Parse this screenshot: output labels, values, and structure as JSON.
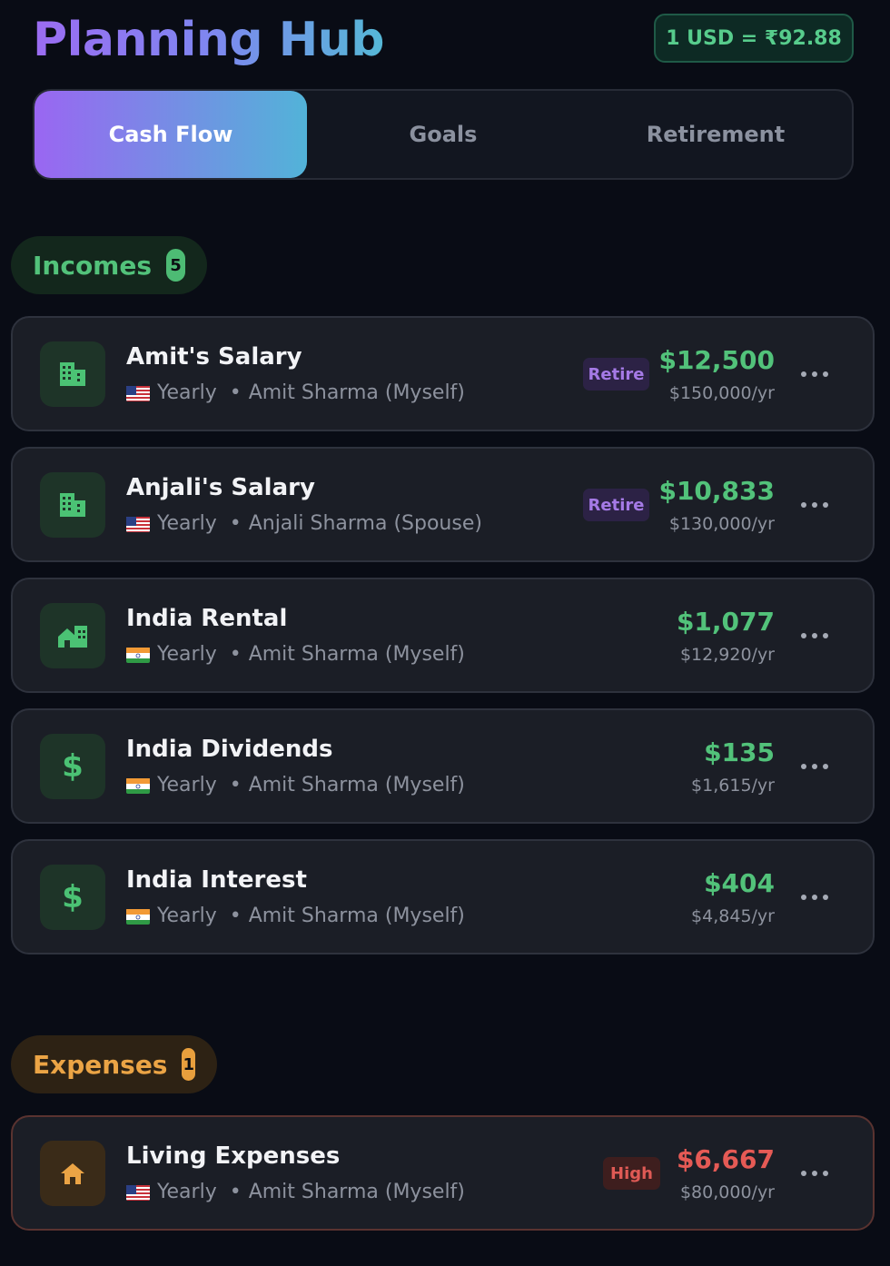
{
  "header": {
    "title": "Planning Hub",
    "exchange_rate": "1 USD = ₹92.88"
  },
  "tabs": [
    {
      "label": "Cash Flow",
      "active": true
    },
    {
      "label": "Goals",
      "active": false
    },
    {
      "label": "Retirement",
      "active": false
    }
  ],
  "incomes": {
    "label": "Incomes",
    "count": "5",
    "items": [
      {
        "name": "Amit's Salary",
        "flag": "us-flag-icon",
        "frequency": "Yearly",
        "owner": "Amit Sharma (Myself)",
        "badge": "Retire",
        "amount": "$12,500",
        "annual": "$150,000/yr",
        "icon": "building-icon"
      },
      {
        "name": "Anjali's Salary",
        "flag": "us-flag-icon",
        "frequency": "Yearly",
        "owner": "Anjali Sharma (Spouse)",
        "badge": "Retire",
        "amount": "$10,833",
        "annual": "$130,000/yr",
        "icon": "building-icon"
      },
      {
        "name": "India Rental",
        "flag": "india-flag-icon",
        "frequency": "Yearly",
        "owner": "Amit Sharma (Myself)",
        "badge": "",
        "amount": "$1,077",
        "annual": "$12,920/yr",
        "icon": "rental-home-icon"
      },
      {
        "name": "India Dividends",
        "flag": "india-flag-icon",
        "frequency": "Yearly",
        "owner": "Amit Sharma (Myself)",
        "badge": "",
        "amount": "$135",
        "annual": "$1,615/yr",
        "icon": "dollar-icon"
      },
      {
        "name": "India Interest",
        "flag": "india-flag-icon",
        "frequency": "Yearly",
        "owner": "Amit Sharma (Myself)",
        "badge": "",
        "amount": "$404",
        "annual": "$4,845/yr",
        "icon": "dollar-icon"
      }
    ]
  },
  "expenses": {
    "label": "Expenses",
    "count": "1",
    "items": [
      {
        "name": "Living Expenses",
        "flag": "us-flag-icon",
        "frequency": "Yearly",
        "owner": "Amit Sharma (Myself)",
        "badge": "High",
        "amount": "$6,667",
        "annual": "$80,000/yr",
        "icon": "home-icon"
      }
    ]
  },
  "icons": {
    "dollar_glyph": "$",
    "separator": "•"
  },
  "colors": {
    "income_green": "#52c27a",
    "expense_orange": "#eba445",
    "expense_red": "#e55a55",
    "retire_purple": "#a57ae6",
    "accent_gradient_start": "#9a66f2",
    "accent_gradient_end": "#52b3d8"
  }
}
